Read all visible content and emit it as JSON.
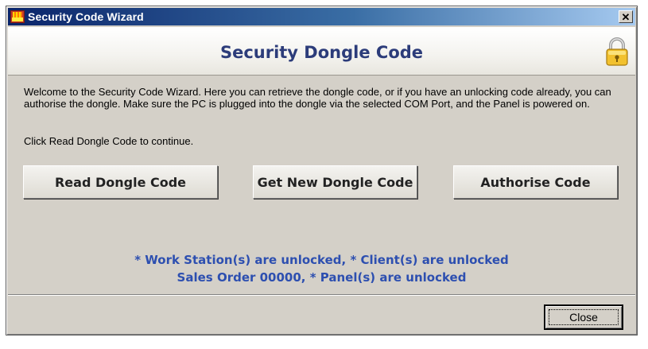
{
  "window": {
    "title": "Security Code Wizard",
    "close_glyph": "✕",
    "app_icon": "fire-alarm-app-icon"
  },
  "header": {
    "title": "Security Dongle Code",
    "icon": "padlock-icon"
  },
  "body": {
    "description": "Welcome to the Security Code Wizard. Here you can retrieve the dongle code, or if you have an unlocking code already, you can authorise the dongle. Make sure the PC is plugged into the dongle via the selected COM Port, and the Panel is powered on.",
    "instruction": "Click Read Dongle Code to continue."
  },
  "buttons": {
    "read": "Read Dongle Code",
    "get_new": "Get New Dongle Code",
    "authorise": "Authorise Code"
  },
  "status": {
    "line1": "* Work Station(s) are unlocked, * Client(s) are unlocked",
    "line2": "Sales Order 00000, * Panel(s) are unlocked"
  },
  "footer": {
    "close_label": "Close"
  },
  "colors": {
    "titlebar_start": "#0a246a",
    "header_title": "#2c3c7a",
    "status_text": "#2d4fb0",
    "window_bg": "#d4d0c8"
  }
}
